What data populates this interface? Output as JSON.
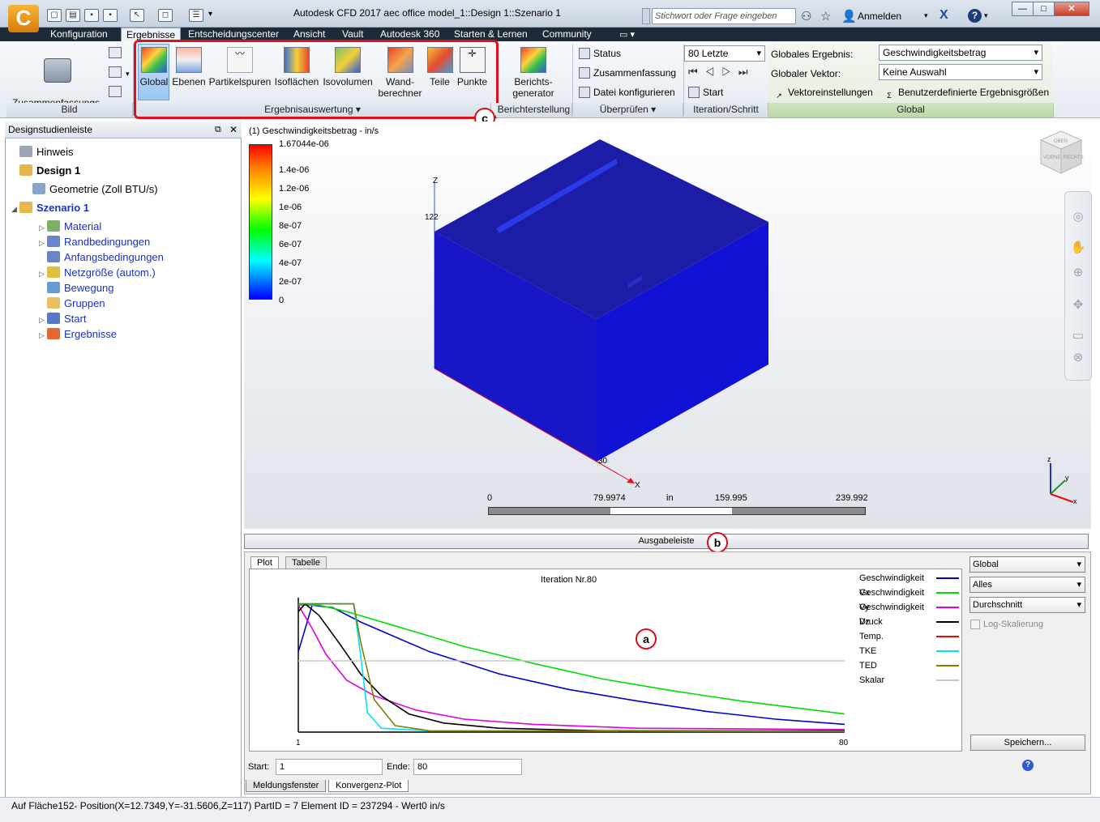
{
  "app": {
    "logo_letter": "C",
    "title": "Autodesk CFD 2017   aec office model_1::Design 1::Szenario 1"
  },
  "titlebar": {
    "search_placeholder": "Stichwort oder Frage eingeben",
    "signin_label": "Anmelden"
  },
  "tabs": [
    "Konfiguration",
    "Ergebnisse",
    "Entscheidungscenter",
    "Ansicht",
    "Vault",
    "Autodesk 360",
    "Starten & Lernen",
    "Community"
  ],
  "ribbon": {
    "bild": {
      "summary_label": "Zusammenfassungs-\nbild",
      "group": "Bild"
    },
    "auswertung": {
      "buttons": [
        "Global",
        "Ebenen",
        "Partikelspuren",
        "Isoflächen",
        "Isovolumen",
        "Wand-\nberechner",
        "Teile",
        "Punkte"
      ],
      "group": "Ergebnisauswertung"
    },
    "bericht": {
      "button": "Berichts-\ngenerator",
      "group": "Berichterstellung"
    },
    "pruefen": {
      "items": [
        "Status",
        "Zusammenfassung",
        "Datei konfigurieren"
      ],
      "group": "Überprüfen"
    },
    "iteration": {
      "combo": "80 Letzte",
      "start": "Start",
      "group": "Iteration/Schritt"
    },
    "global": {
      "result_label": "Globales Ergebnis:",
      "result_value": "Geschwindigkeitsbetrag",
      "vector_label": "Globaler Vektor:",
      "vector_value": "Keine Auswahl",
      "vector_settings": "Vektoreinstellungen",
      "custom_results": "Benutzerdefinierte Ergebnisgrößen",
      "group": "Global"
    },
    "callout_c": "c"
  },
  "leftpanel": {
    "title": "Designstudienleiste",
    "tree": [
      {
        "label": "Hinweis",
        "bold": false,
        "blue": false
      },
      {
        "label": "Design 1",
        "bold": true,
        "blue": false
      },
      {
        "label": "Geometrie (Zoll BTU/s)",
        "bold": false,
        "blue": false
      },
      {
        "label": "Szenario 1",
        "bold": true,
        "blue": true
      },
      {
        "label": "Material",
        "bold": false,
        "blue": true
      },
      {
        "label": "Randbedingungen",
        "bold": false,
        "blue": true
      },
      {
        "label": "Anfangsbedingungen",
        "bold": false,
        "blue": true
      },
      {
        "label": "Netzgröße (autom.)",
        "bold": false,
        "blue": true
      },
      {
        "label": "Bewegung",
        "bold": false,
        "blue": true
      },
      {
        "label": "Gruppen",
        "bold": false,
        "blue": true
      },
      {
        "label": "Start",
        "bold": false,
        "blue": true
      },
      {
        "label": "Ergebnisse",
        "bold": false,
        "blue": true
      }
    ]
  },
  "viewport": {
    "legend_title": "(1) Geschwindigkeitsbetrag - in/s",
    "legend_ticks": [
      "1.67044e-06",
      "1.4e-06",
      "1.2e-06",
      "1e-06",
      "8e-07",
      "6e-07",
      "4e-07",
      "2e-07",
      "0"
    ],
    "axis_z": "Z",
    "axis_x": "X",
    "label_122": "122",
    "label_30": "30",
    "ruler": {
      "labels": [
        "0",
        "79.9974",
        "in",
        "159.995",
        "239.992"
      ]
    },
    "viewcube": {
      "face1": "OBEN",
      "face2": "VORNE",
      "face3": "RECHTS"
    },
    "triad": {
      "z": "z",
      "y": "y",
      "x": "x"
    }
  },
  "output": {
    "header": "Ausgabeleiste",
    "callout_b": "b",
    "callout_a": "a",
    "tabs": [
      "Plot",
      "Tabelle"
    ],
    "bottom_tabs": [
      "Meldungsfenster",
      "Konvergenz-Plot"
    ],
    "start_label": "Start:",
    "start_value": "1",
    "end_label": "Ende:",
    "end_value": "80",
    "dropdowns": [
      "Global",
      "Alles",
      "Durchschnitt"
    ],
    "log_label": "Log-Skalierung",
    "save_label": "Speichern...",
    "help_icon": "?"
  },
  "chart_data": {
    "type": "line",
    "title": "Iteration Nr.80",
    "xlim": [
      1,
      80
    ],
    "x_ticks": [
      "1",
      "80"
    ],
    "series": [
      {
        "name": "Geschwindigkeit Vx",
        "color": "#0000cc",
        "points": [
          [
            1,
            0.62
          ],
          [
            3,
            0.98
          ],
          [
            6,
            0.96
          ],
          [
            10,
            0.85
          ],
          [
            20,
            0.62
          ],
          [
            30,
            0.45
          ],
          [
            40,
            0.33
          ],
          [
            50,
            0.24
          ],
          [
            60,
            0.16
          ],
          [
            70,
            0.1
          ],
          [
            80,
            0.06
          ]
        ]
      },
      {
        "name": "Geschwindigkeit Vy",
        "color": "#00dd00",
        "points": [
          [
            1,
            0.98
          ],
          [
            4,
            0.98
          ],
          [
            8,
            0.93
          ],
          [
            15,
            0.82
          ],
          [
            25,
            0.66
          ],
          [
            35,
            0.53
          ],
          [
            45,
            0.41
          ],
          [
            55,
            0.32
          ],
          [
            65,
            0.24
          ],
          [
            80,
            0.14
          ]
        ]
      },
      {
        "name": "Geschwindigkeit Vz",
        "color": "#e000e0",
        "points": [
          [
            1,
            0.98
          ],
          [
            3,
            0.8
          ],
          [
            5,
            0.6
          ],
          [
            8,
            0.4
          ],
          [
            12,
            0.28
          ],
          [
            18,
            0.17
          ],
          [
            25,
            0.1
          ],
          [
            35,
            0.06
          ],
          [
            50,
            0.03
          ],
          [
            80,
            0.02
          ]
        ]
      },
      {
        "name": "Druck",
        "color": "#000000",
        "points": [
          [
            1,
            0.93
          ],
          [
            2,
            0.99
          ],
          [
            4,
            0.9
          ],
          [
            7,
            0.68
          ],
          [
            10,
            0.45
          ],
          [
            13,
            0.28
          ],
          [
            17,
            0.14
          ],
          [
            22,
            0.07
          ],
          [
            30,
            0.03
          ],
          [
            45,
            0.01
          ],
          [
            80,
            0.01
          ]
        ]
      },
      {
        "name": "Temp.",
        "color": "#ff0000",
        "points": []
      },
      {
        "name": "TKE",
        "color": "#00e0ff",
        "points": [
          [
            1,
            0.99
          ],
          [
            9,
            0.99
          ],
          [
            10,
            0.6
          ],
          [
            11,
            0.15
          ],
          [
            13,
            0.03
          ],
          [
            20,
            0.01
          ],
          [
            80,
            0.005
          ]
        ]
      },
      {
        "name": "TED",
        "color": "#808000",
        "points": [
          [
            1,
            0.99
          ],
          [
            9,
            0.99
          ],
          [
            10,
            0.7
          ],
          [
            12,
            0.25
          ],
          [
            15,
            0.05
          ],
          [
            20,
            0.01
          ],
          [
            80,
            0.005
          ]
        ]
      },
      {
        "name": "Skalar",
        "color": "#c8c8c8",
        "points": [
          [
            1,
            0.55
          ],
          [
            80,
            0.55
          ]
        ]
      }
    ]
  },
  "status": "Auf Fläche152- Position(X=12.7349,Y=-31.5606,Z=117) PartID = 7 Element ID = 237294 - Wert0  in/s"
}
